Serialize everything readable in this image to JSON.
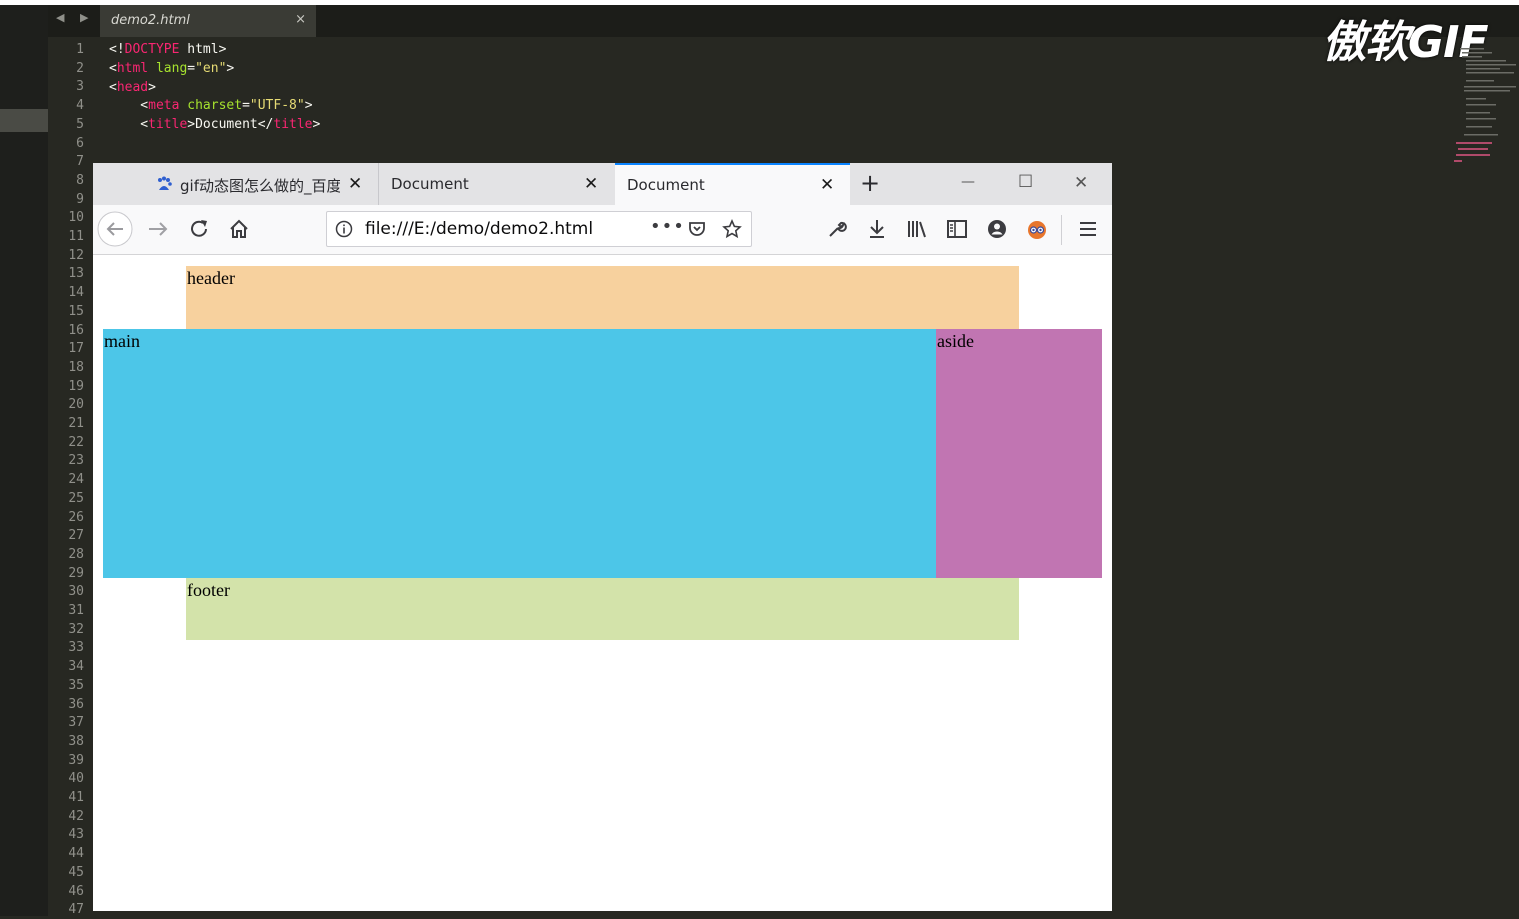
{
  "editor": {
    "nav_arrows": "◀ ▶",
    "tab": {
      "filename": "demo2.html",
      "close": "×"
    },
    "line_numbers": [
      "1",
      "2",
      "3",
      "4",
      "5",
      "6",
      "7",
      "8",
      "9",
      "10",
      "11",
      "12",
      "13",
      "14",
      "15",
      "16",
      "17",
      "18",
      "19",
      "20",
      "21",
      "22",
      "23",
      "24",
      "25",
      "26",
      "27",
      "28",
      "29",
      "30",
      "31",
      "32",
      "33",
      "34",
      "35",
      "36",
      "37",
      "38",
      "39",
      "40",
      "41",
      "42",
      "43",
      "44",
      "45",
      "46",
      "47"
    ],
    "code": {
      "l1_open": "<!",
      "l1_doctype": "DOCTYPE",
      "l1_rest": " html>",
      "l2_open": "<",
      "l2_tag": "html",
      "l2_attr": " lang",
      "l2_eq": "=",
      "l2_val": "\"en\"",
      "l2_close": ">",
      "l3_open": "<",
      "l3_tag": "head",
      "l3_close": ">",
      "l4_open": "    <",
      "l4_tag": "meta",
      "l4_attr": " charset",
      "l4_eq": "=",
      "l4_val": "\"UTF-8\"",
      "l4_close": ">",
      "l5_open": "    <",
      "l5_tag": "title",
      "l5_mid": ">Document</",
      "l5_tag2": "title",
      "l5_close": ">"
    },
    "watermark": "傲软GIF"
  },
  "browser": {
    "tabs": [
      {
        "label": "gif动态图怎么做的_百度",
        "close": "✕"
      },
      {
        "label": "Document",
        "close": "✕"
      },
      {
        "label": "Document",
        "close": "✕"
      }
    ],
    "new_tab": "+",
    "window_controls": {
      "minimize": "—",
      "maximize": "☐",
      "close": "✕"
    },
    "url": "file:///E:/demo/demo2.html",
    "toolbar_icons": [
      "back-icon",
      "forward-icon",
      "reload-icon",
      "home-icon",
      "info-icon",
      "more-icon",
      "pocket-icon",
      "bookmark-star-icon",
      "wrench-icon",
      "download-icon",
      "library-icon",
      "sidebar-icon",
      "account-icon",
      "extension-icon",
      "menu-icon"
    ]
  },
  "page": {
    "header": "header",
    "main": "main",
    "aside": "aside",
    "footer": "footer",
    "colors": {
      "header": "#f7d19e",
      "main": "#4cc6e8",
      "aside": "#c175b2",
      "footer": "#d3e3aa"
    }
  }
}
